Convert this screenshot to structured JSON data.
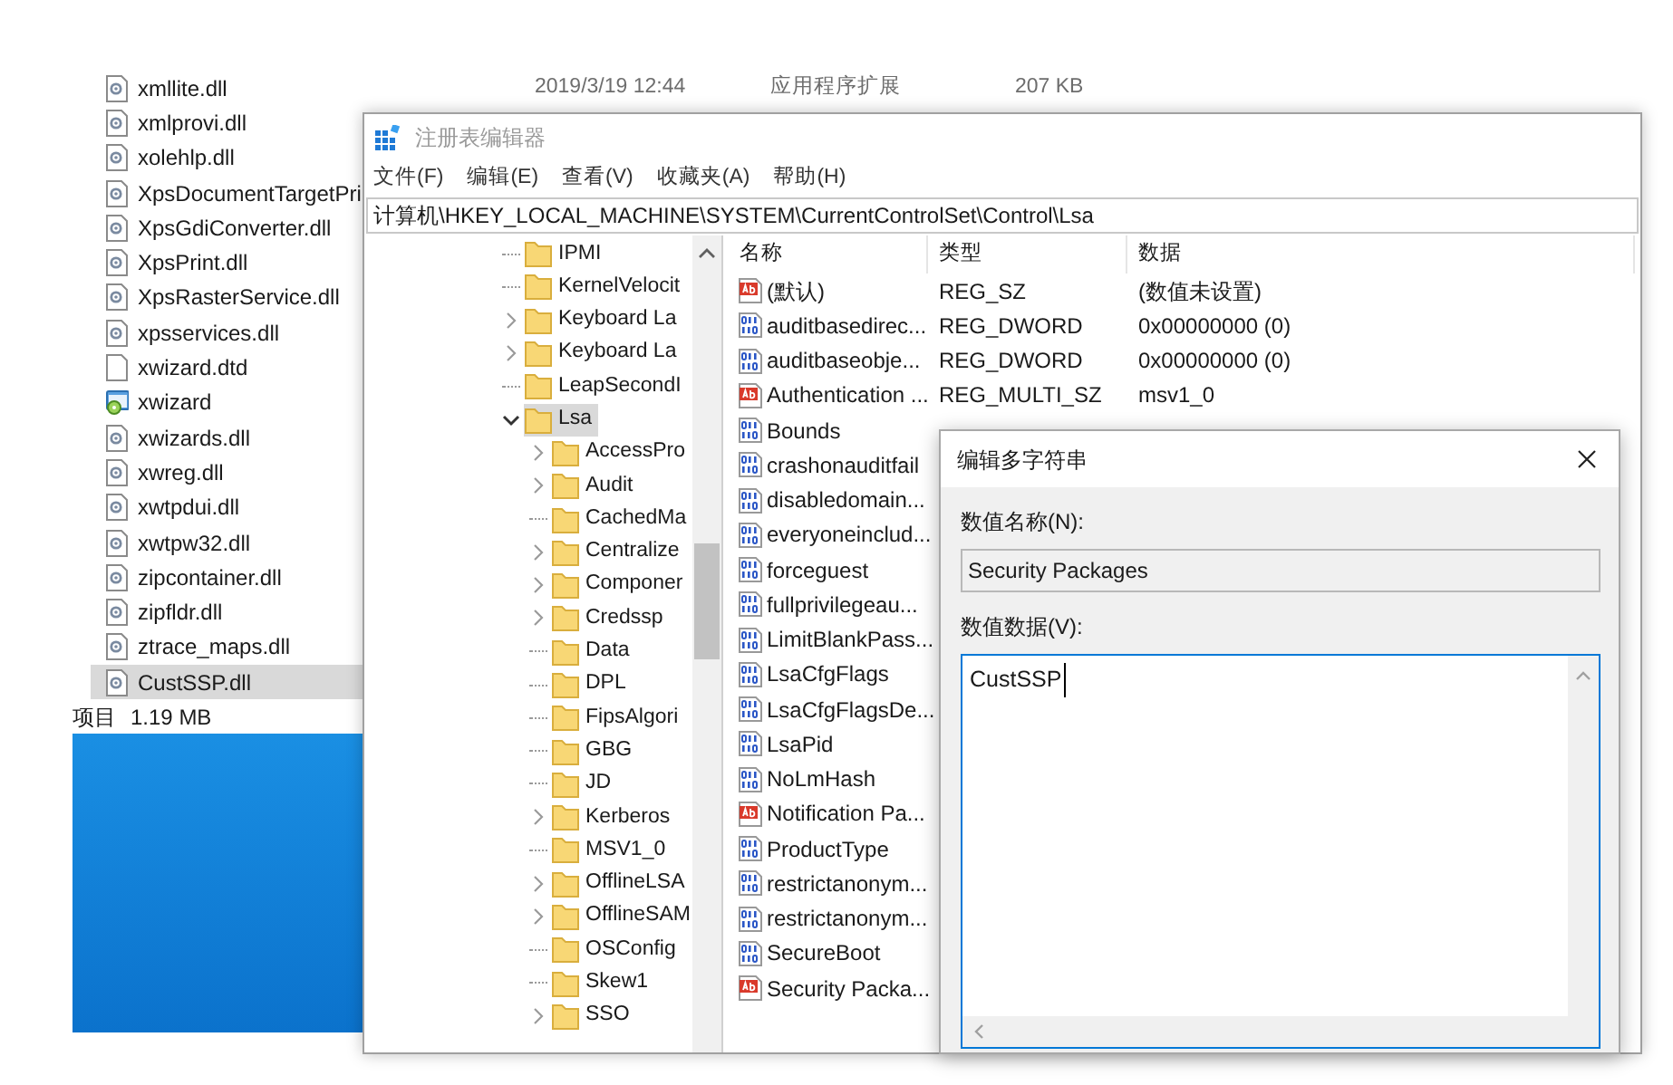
{
  "explorer": {
    "files": [
      {
        "name": "xmllite.dll",
        "kind": "dll",
        "selected": false,
        "date": "2019/3/19 12:44",
        "type": "应用程序扩展",
        "size": "207 KB"
      },
      {
        "name": "xmlprovi.dll",
        "kind": "dll",
        "selected": false
      },
      {
        "name": "xolehlp.dll",
        "kind": "dll",
        "selected": false
      },
      {
        "name": "XpsDocumentTargetPri",
        "kind": "dll",
        "selected": false
      },
      {
        "name": "XpsGdiConverter.dll",
        "kind": "dll",
        "selected": false
      },
      {
        "name": "XpsPrint.dll",
        "kind": "dll",
        "selected": false
      },
      {
        "name": "XpsRasterService.dll",
        "kind": "dll",
        "selected": false
      },
      {
        "name": "xpsservices.dll",
        "kind": "dll",
        "selected": false
      },
      {
        "name": "xwizard.dtd",
        "kind": "file",
        "selected": false
      },
      {
        "name": "xwizard",
        "kind": "app",
        "selected": false
      },
      {
        "name": "xwizards.dll",
        "kind": "dll",
        "selected": false
      },
      {
        "name": "xwreg.dll",
        "kind": "dll",
        "selected": false
      },
      {
        "name": "xwtpdui.dll",
        "kind": "dll",
        "selected": false
      },
      {
        "name": "xwtpw32.dll",
        "kind": "dll",
        "selected": false
      },
      {
        "name": "zipcontainer.dll",
        "kind": "dll",
        "selected": false
      },
      {
        "name": "zipfldr.dll",
        "kind": "dll",
        "selected": false
      },
      {
        "name": "ztrace_maps.dll",
        "kind": "dll",
        "selected": false
      },
      {
        "name": "CustSSP.dll",
        "kind": "dll",
        "selected": true
      }
    ],
    "status_label": "项目",
    "status_size": "1.19 MB"
  },
  "registry_editor": {
    "title": "注册表编辑器",
    "menu": [
      "文件(F)",
      "编辑(E)",
      "查看(V)",
      "收藏夹(A)",
      "帮助(H)"
    ],
    "address": "计算机\\HKEY_LOCAL_MACHINE\\SYSTEM\\CurrentControlSet\\Control\\Lsa",
    "tree": [
      {
        "label": "IPMI",
        "selected": false
      },
      {
        "label": "KernelVelocit",
        "selected": false
      },
      {
        "label": "Keyboard La",
        "expanded": false,
        "selected": false
      },
      {
        "label": "Keyboard La",
        "expanded": false,
        "selected": false
      },
      {
        "label": "LeapSecondI",
        "selected": false
      },
      {
        "label": "Lsa",
        "expanded": true,
        "selected": true,
        "children": [
          {
            "label": "AccessPro",
            "expanded": false,
            "selected": false
          },
          {
            "label": "Audit",
            "expanded": false,
            "selected": false
          },
          {
            "label": "CachedMa",
            "selected": false
          },
          {
            "label": "Centralize",
            "expanded": false,
            "selected": false
          },
          {
            "label": "Componer",
            "expanded": false,
            "selected": false
          },
          {
            "label": "Credssp",
            "expanded": false,
            "selected": false
          },
          {
            "label": "Data",
            "selected": false
          },
          {
            "label": "DPL",
            "selected": false
          },
          {
            "label": "FipsAlgori",
            "selected": false
          },
          {
            "label": "GBG",
            "selected": false
          },
          {
            "label": "JD",
            "selected": false
          },
          {
            "label": "Kerberos",
            "expanded": false,
            "selected": false
          },
          {
            "label": "MSV1_0",
            "selected": false
          },
          {
            "label": "OfflineLSA",
            "expanded": false,
            "selected": false
          },
          {
            "label": "OfflineSAM",
            "expanded": false,
            "selected": false
          },
          {
            "label": "OSConfig",
            "selected": false
          },
          {
            "label": "Skew1",
            "selected": false
          },
          {
            "label": "SSO",
            "expanded": false,
            "selected": false
          }
        ]
      }
    ],
    "columns": [
      "名称",
      "类型",
      "数据"
    ],
    "values": [
      {
        "name": "(默认)",
        "kind": "string",
        "type": "REG_SZ",
        "data": "(数值未设置)"
      },
      {
        "name": "auditbasedirec...",
        "kind": "binary",
        "type": "REG_DWORD",
        "data": "0x00000000 (0)"
      },
      {
        "name": "auditbaseobje...",
        "kind": "binary",
        "type": "REG_DWORD",
        "data": "0x00000000 (0)"
      },
      {
        "name": "Authentication ...",
        "kind": "string",
        "type": "REG_MULTI_SZ",
        "data": "msv1_0"
      },
      {
        "name": "Bounds",
        "kind": "binary"
      },
      {
        "name": "crashonauditfail",
        "kind": "binary"
      },
      {
        "name": "disabledomain...",
        "kind": "binary"
      },
      {
        "name": "everyoneinclud...",
        "kind": "binary"
      },
      {
        "name": "forceguest",
        "kind": "binary"
      },
      {
        "name": "fullprivilegeau...",
        "kind": "binary"
      },
      {
        "name": "LimitBlankPass...",
        "kind": "binary"
      },
      {
        "name": "LsaCfgFlags",
        "kind": "binary"
      },
      {
        "name": "LsaCfgFlagsDe...",
        "kind": "binary"
      },
      {
        "name": "LsaPid",
        "kind": "binary"
      },
      {
        "name": "NoLmHash",
        "kind": "binary"
      },
      {
        "name": "Notification Pa...",
        "kind": "string"
      },
      {
        "name": "ProductType",
        "kind": "binary"
      },
      {
        "name": "restrictanonym...",
        "kind": "binary"
      },
      {
        "name": "restrictanonym...",
        "kind": "binary"
      },
      {
        "name": "SecureBoot",
        "kind": "binary"
      },
      {
        "name": "Security Packa...",
        "kind": "string"
      }
    ]
  },
  "dialog": {
    "title": "编辑多字符串",
    "name_label": "数值名称(N):",
    "name_value": "Security Packages",
    "data_label": "数值数据(V):",
    "data_value": "CustSSP"
  }
}
